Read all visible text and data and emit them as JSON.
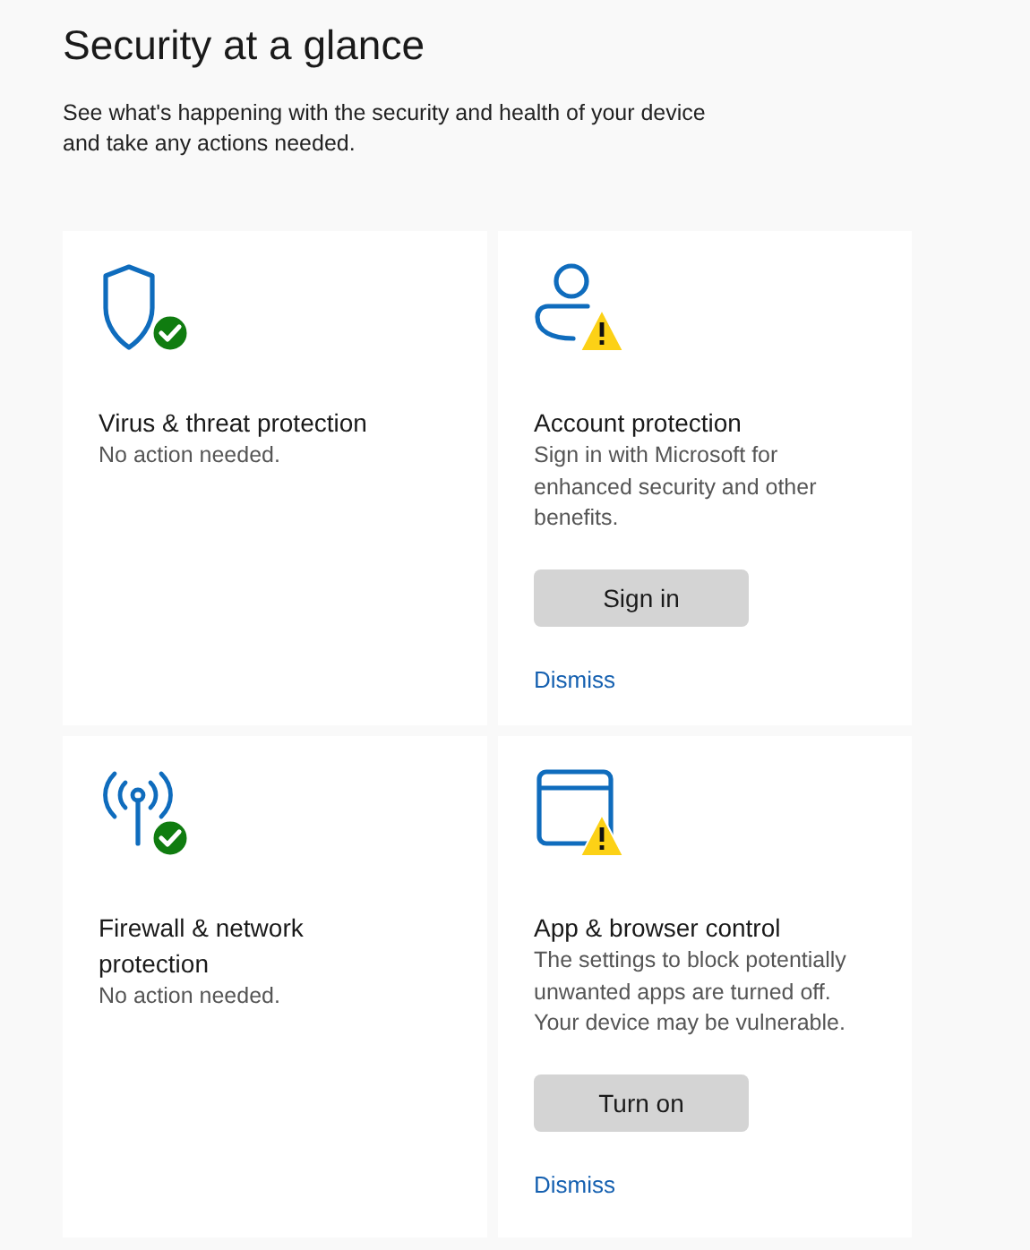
{
  "title": "Security at a glance",
  "subtitle": "See what's happening with the security and health of your device and take any actions needed.",
  "cards": [
    {
      "kind": "shield",
      "warning": false,
      "title": "Virus & threat protection",
      "description": "No action needed."
    },
    {
      "kind": "person",
      "warning": true,
      "title": "Account protection",
      "description": "Sign in with Microsoft for enhanced security and other benefits.",
      "button": "Sign in",
      "link": "Dismiss"
    },
    {
      "kind": "antenna",
      "warning": false,
      "title": "Firewall & network protection",
      "description": "No action needed."
    },
    {
      "kind": "window",
      "warning": true,
      "title": "App & browser control",
      "description": "The settings to block potentially unwanted apps are turned off. Your device may be vulnerable.",
      "button": "Turn on",
      "link": "Dismiss"
    }
  ]
}
